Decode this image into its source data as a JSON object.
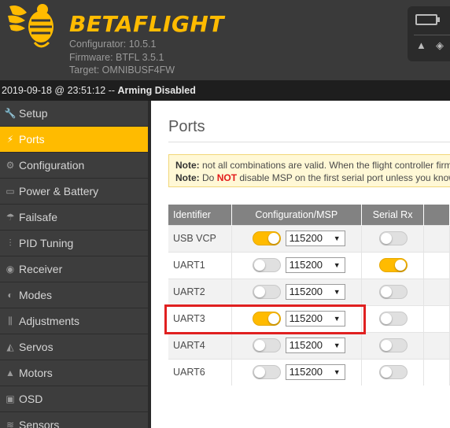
{
  "header": {
    "brand": "BETAFLIGHT",
    "configurator": "Configurator: 10.5.1",
    "firmware": "Firmware: BTFL 3.5.1",
    "target": "Target: OMNIBUSF4FW"
  },
  "logbar": {
    "timestamp": "2019-09-18 @ 23:51:12 --",
    "status": "Arming Disabled"
  },
  "sidebar": {
    "items": [
      {
        "label": "Setup",
        "icon": "wrench-icon",
        "glyph": "🔧"
      },
      {
        "label": "Ports",
        "icon": "plug-icon",
        "glyph": "⚡",
        "active": true
      },
      {
        "label": "Configuration",
        "icon": "gear-icon",
        "glyph": "⚙"
      },
      {
        "label": "Power & Battery",
        "icon": "battery-icon",
        "glyph": "▭"
      },
      {
        "label": "Failsafe",
        "icon": "parachute-icon",
        "glyph": "☂"
      },
      {
        "label": "PID Tuning",
        "icon": "sliders-icon",
        "glyph": "⫶"
      },
      {
        "label": "Receiver",
        "icon": "receiver-icon",
        "glyph": "◉"
      },
      {
        "label": "Modes",
        "icon": "toggle-icon",
        "glyph": "◐"
      },
      {
        "label": "Adjustments",
        "icon": "adjust-icon",
        "glyph": "⫼"
      },
      {
        "label": "Servos",
        "icon": "servo-icon",
        "glyph": "◭"
      },
      {
        "label": "Motors",
        "icon": "motor-icon",
        "glyph": "▲"
      },
      {
        "label": "OSD",
        "icon": "osd-icon",
        "glyph": "▣"
      },
      {
        "label": "Sensors",
        "icon": "sensor-icon",
        "glyph": "≋"
      }
    ]
  },
  "content": {
    "title": "Ports",
    "note1_label": "Note:",
    "note1_text": " not all combinations are valid. When the flight controller firmw",
    "note2_label": "Note:",
    "note2_pre": " Do ",
    "note2_not": "NOT",
    "note2_post": " disable MSP on the first serial port unless you know w"
  },
  "table": {
    "headers": [
      "Identifier",
      "Configuration/MSP",
      "Serial Rx"
    ],
    "rows": [
      {
        "id": "USB VCP",
        "msp": true,
        "baud": "115200",
        "rx": false
      },
      {
        "id": "UART1",
        "msp": false,
        "baud": "115200",
        "rx": true
      },
      {
        "id": "UART2",
        "msp": false,
        "baud": "115200",
        "rx": false
      },
      {
        "id": "UART3",
        "msp": true,
        "baud": "115200",
        "rx": false
      },
      {
        "id": "UART4",
        "msp": false,
        "baud": "115200",
        "rx": false
      },
      {
        "id": "UART6",
        "msp": false,
        "baud": "115200",
        "rx": false
      }
    ]
  },
  "colors": {
    "accent": "#ffbb00",
    "highlight": "#e02020"
  }
}
